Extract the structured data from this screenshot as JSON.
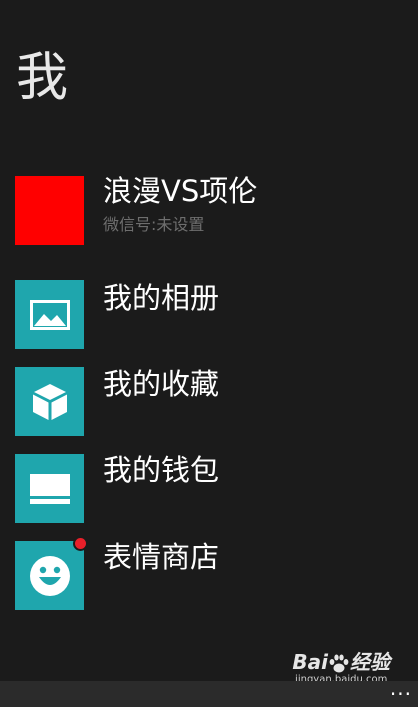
{
  "header": {
    "title": "我"
  },
  "profile": {
    "name": "浪漫VS项伦",
    "wechat_id": "微信号:未设置",
    "avatar_color": "#ff0000"
  },
  "menu": {
    "items": [
      {
        "label": "我的相册",
        "icon": "photo-icon"
      },
      {
        "label": "我的收藏",
        "icon": "cube-icon"
      },
      {
        "label": "我的钱包",
        "icon": "wallet-icon"
      },
      {
        "label": "表情商店",
        "icon": "smiley-icon",
        "badge": true
      }
    ]
  },
  "appbar": {
    "more": "..."
  },
  "watermark": {
    "logo_text_left": "Bai",
    "logo_text_right": "经验",
    "url": "jingyan.baidu.com"
  },
  "colors": {
    "background": "#1b1b1b",
    "tile": "#1fa6ad",
    "badge": "#e8202a",
    "subtext": "#6e6e6e"
  }
}
